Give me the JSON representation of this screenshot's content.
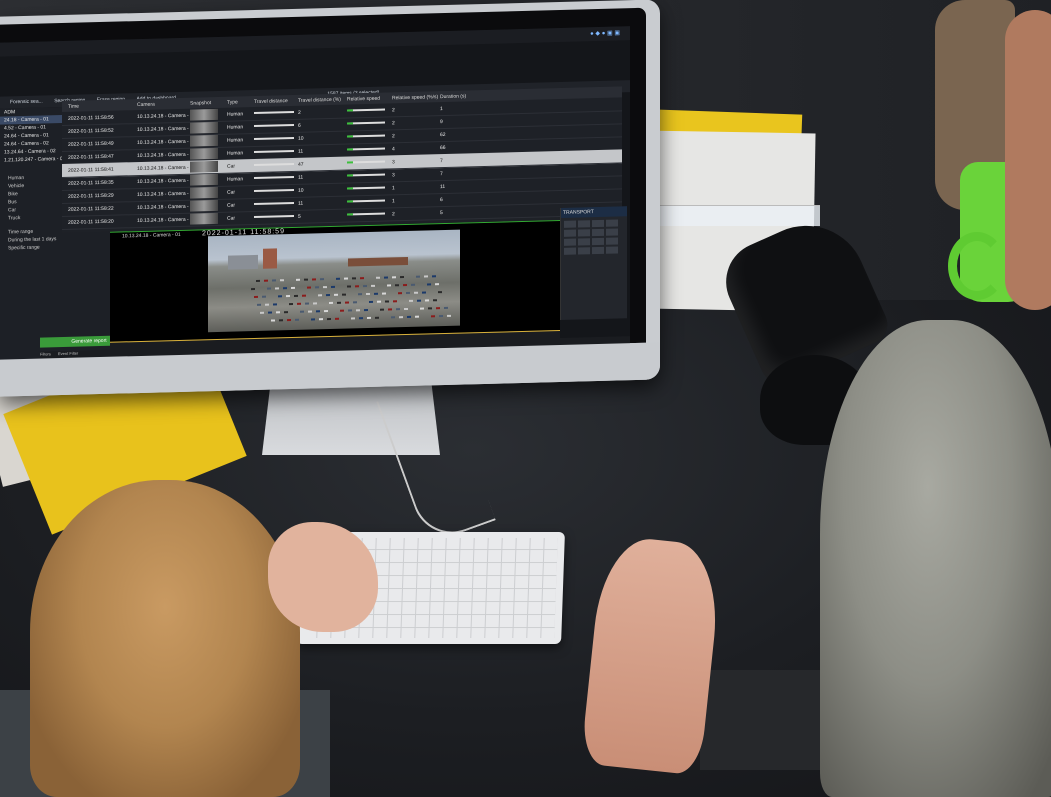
{
  "app": {
    "window_tab": "Forensic sea...",
    "toolbar": [
      "Search region",
      "Erase region",
      "Add to dashboard"
    ],
    "table_caption": "1587 items (3 selected)",
    "columns": [
      "Time",
      "Camera",
      "Snapshot",
      "Type",
      "Travel distance",
      "Travel distance (%)",
      "Relative speed",
      "Relative speed (%/s)",
      "Duration (s)"
    ],
    "rows": [
      {
        "time": "2022-01-11 11:58:56",
        "camera": "10.13.24.18 - Camera - 01",
        "type": "Human",
        "n1": "2",
        "n2": "2",
        "dur": "1"
      },
      {
        "time": "2022-01-11 11:58:52",
        "camera": "10.13.24.18 - Camera - 01",
        "type": "Human",
        "n1": "6",
        "n2": "2",
        "dur": "9"
      },
      {
        "time": "2022-01-11 11:58:49",
        "camera": "10.13.24.18 - Camera - 01",
        "type": "Human",
        "n1": "10",
        "n2": "2",
        "dur": "62"
      },
      {
        "time": "2022-01-11 11:58:47",
        "camera": "10.13.24.18 - Camera - 01",
        "type": "Human",
        "n1": "11",
        "n2": "4",
        "dur": "66"
      },
      {
        "time": "2022-01-11 11:58:41",
        "camera": "10.13.24.18 - Camera - 01",
        "type": "Car",
        "n1": "47",
        "n2": "3",
        "dur": "7"
      },
      {
        "time": "2022-01-11 11:58:35",
        "camera": "10.13.24.18 - Camera - 01",
        "type": "Human",
        "n1": "11",
        "n2": "3",
        "dur": "7"
      },
      {
        "time": "2022-01-11 11:58:29",
        "camera": "10.13.24.18 - Camera - 01",
        "type": "Car",
        "n1": "10",
        "n2": "1",
        "dur": "11"
      },
      {
        "time": "2022-01-11 11:58:22",
        "camera": "10.13.24.18 - Camera - 01",
        "type": "Car",
        "n1": "11",
        "n2": "1",
        "dur": "6"
      },
      {
        "time": "2022-01-11 11:58:20",
        "camera": "10.13.24.18 - Camera - 01",
        "type": "Car",
        "n1": "5",
        "n2": "2",
        "dur": "5"
      }
    ],
    "sidebar": {
      "cameras": [
        "ADM",
        "24.18 - Camera - 01",
        "4.52 - Camera - 01",
        "24.64 - Camera - 01",
        "24.64 - Camera - 02",
        "13.24.64 - Camera - 02",
        "1.21.120.247 - Camera - 01"
      ],
      "types": [
        "Human",
        "Vehicle",
        "Bike",
        "Bus",
        "Car",
        "Truck"
      ],
      "time_range_label": "Time range",
      "time_option_1": "During the last",
      "time_value": "1",
      "time_unit": "days",
      "time_option_2": "Specific range",
      "generate_button": "Generate report"
    },
    "video": {
      "label": "10.13.24.18 - Camera - 01",
      "timestamp": "2022-01-11 11:58:59"
    },
    "control_panel": {
      "title": "TRANSPORT"
    },
    "bottom_tabs": [
      "Filters",
      "Event Filter"
    ]
  },
  "colors": {
    "accent_green": "#3cc03c",
    "highlight_row": "#c4c6c9",
    "mug": "#6ad33a",
    "folder": "#e8c21c"
  }
}
